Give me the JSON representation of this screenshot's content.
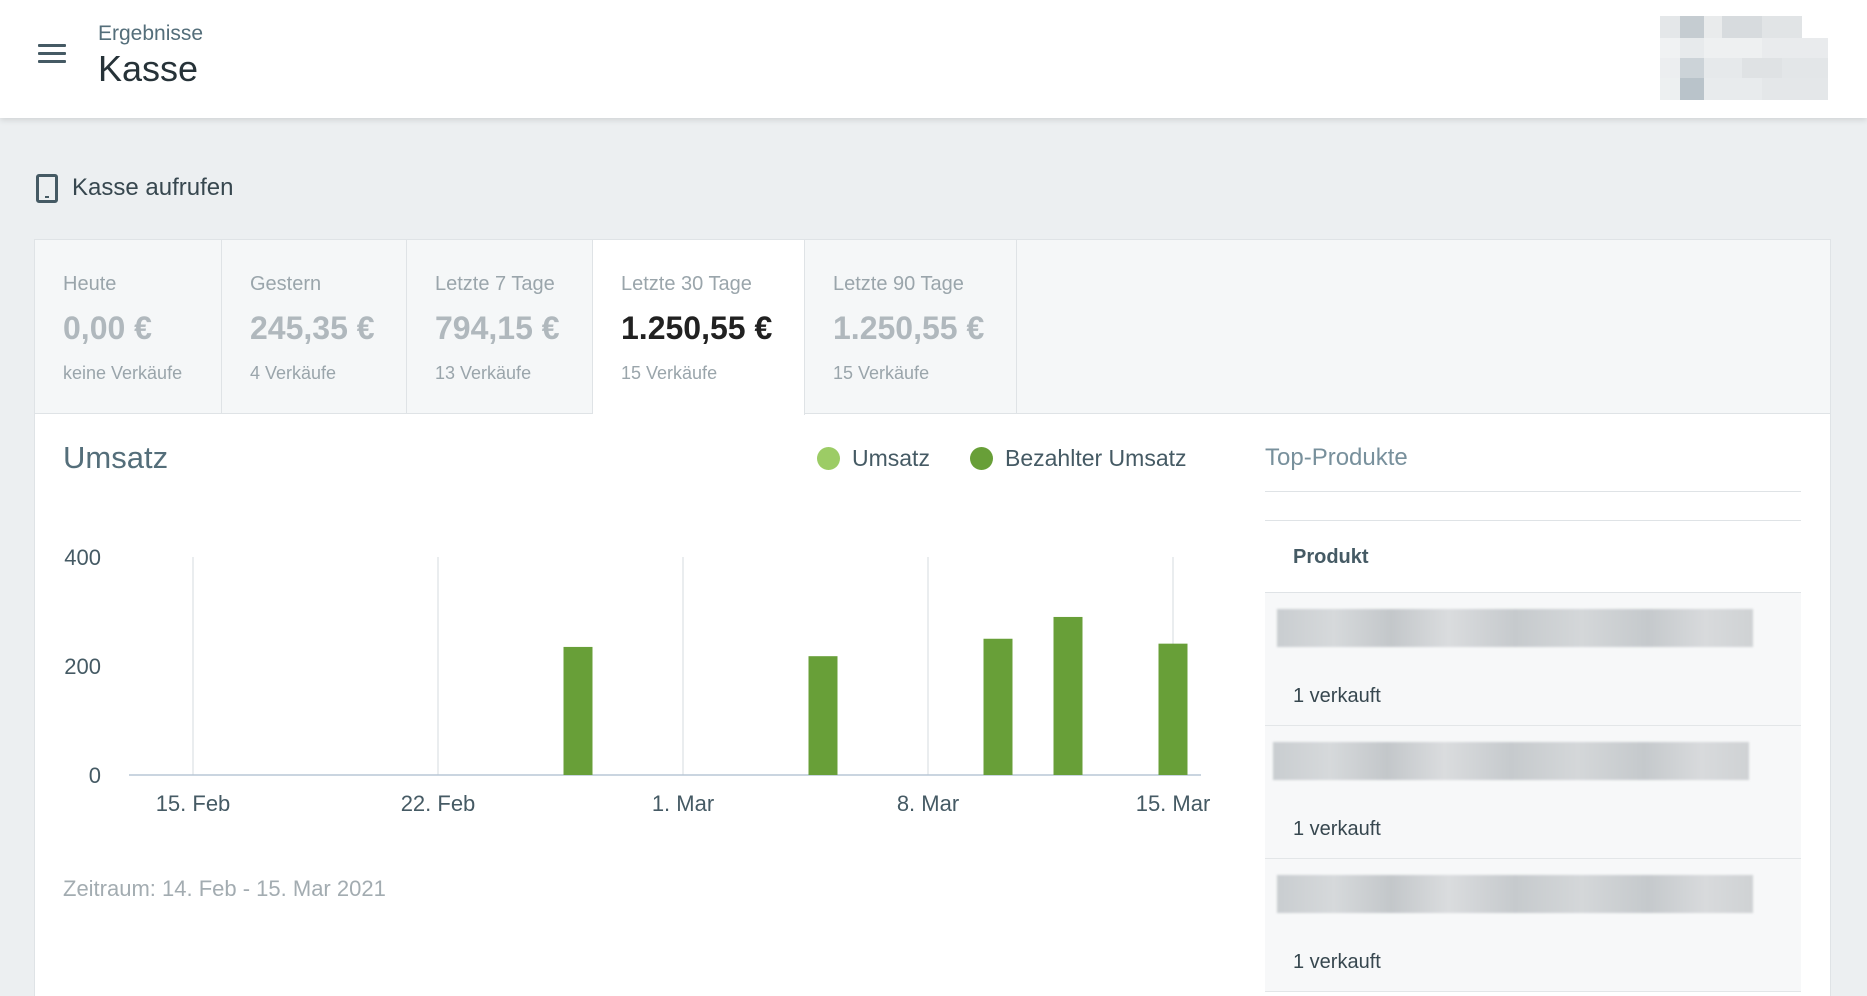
{
  "header": {
    "breadcrumb": "Ergebnisse",
    "title": "Kasse"
  },
  "actions": {
    "open_register": "Kasse aufrufen"
  },
  "tabs": [
    {
      "label": "Heute",
      "amount": "0,00 €",
      "count": "keine Verkäufe"
    },
    {
      "label": "Gestern",
      "amount": "245,35 €",
      "count": "4 Verkäufe"
    },
    {
      "label": "Letzte 7 Tage",
      "amount": "794,15 €",
      "count": "13 Verkäufe"
    },
    {
      "label": "Letzte 30 Tage",
      "amount": "1.250,55 €",
      "count": "15 Verkäufe"
    },
    {
      "label": "Letzte 90 Tage",
      "amount": "1.250,55 €",
      "count": "15 Verkäufe"
    }
  ],
  "active_tab": "Letzte 30 Tage",
  "revenue": {
    "title": "Umsatz",
    "range": "Zeitraum: 14. Feb - 15. Mar 2021"
  },
  "chart_data": {
    "type": "bar",
    "x_start": "2021-02-14",
    "x_end": "2021-03-15",
    "x_ticks": [
      {
        "date": "2021-02-15",
        "label": "15. Feb"
      },
      {
        "date": "2021-02-22",
        "label": "22. Feb"
      },
      {
        "date": "2021-03-01",
        "label": "1. Mar"
      },
      {
        "date": "2021-03-08",
        "label": "8. Mar"
      },
      {
        "date": "2021-03-15",
        "label": "15. Mar"
      }
    ],
    "y_ticks": [
      0,
      200,
      400
    ],
    "ylim": [
      0,
      400
    ],
    "legend": [
      {
        "name": "Umsatz",
        "color": "#9ccc65"
      },
      {
        "name": "Bezahlter Umsatz",
        "color": "#689f38"
      }
    ],
    "legend_position": "top-right",
    "series": [
      {
        "name": "Bezahlter Umsatz",
        "color": "#689f38",
        "points": [
          {
            "x": "2021-02-26",
            "y": 235
          },
          {
            "x": "2021-03-05",
            "y": 218
          },
          {
            "x": "2021-03-10",
            "y": 250
          },
          {
            "x": "2021-03-12",
            "y": 290
          },
          {
            "x": "2021-03-15",
            "y": 241
          }
        ]
      }
    ]
  },
  "top_products": {
    "title": "Top-Produkte",
    "column": "Produkt",
    "items": [
      {
        "sold": "1 verkauft"
      },
      {
        "sold": "1 verkauft"
      },
      {
        "sold": "1 verkauft"
      }
    ]
  }
}
